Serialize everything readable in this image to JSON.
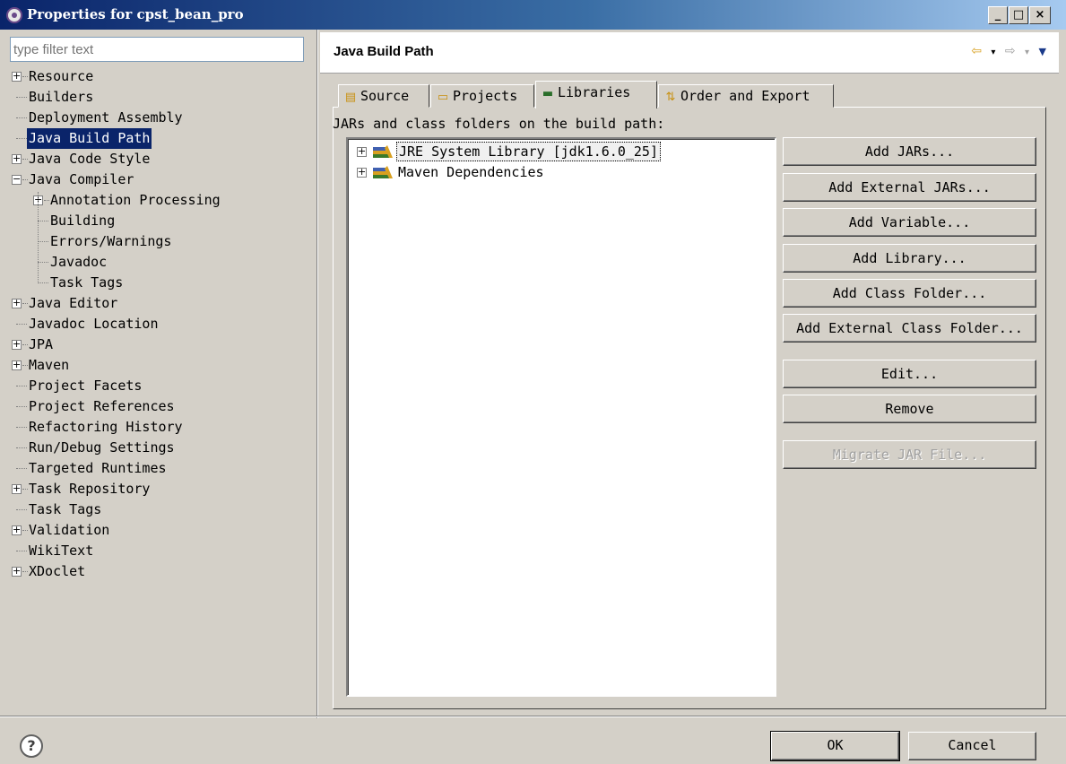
{
  "window": {
    "title": "Properties for cpst_bean_pro",
    "minimize_label": "_",
    "maximize_label": "□",
    "close_label": "×"
  },
  "filter": {
    "placeholder": "type filter text"
  },
  "tree": [
    {
      "label": "Resource",
      "expand": "+"
    },
    {
      "label": "Builders"
    },
    {
      "label": "Deployment Assembly"
    },
    {
      "label": "Java Build Path",
      "selected": true
    },
    {
      "label": "Java Code Style",
      "expand": "+"
    },
    {
      "label": "Java Compiler",
      "expand": "−"
    },
    {
      "label": "Annotation Processing",
      "expand": "+",
      "child": true
    },
    {
      "label": "Building",
      "child": true
    },
    {
      "label": "Errors/Warnings",
      "child": true
    },
    {
      "label": "Javadoc",
      "child": true
    },
    {
      "label": "Task Tags",
      "child": true
    },
    {
      "label": "Java Editor",
      "expand": "+"
    },
    {
      "label": "Javadoc Location"
    },
    {
      "label": "JPA",
      "expand": "+"
    },
    {
      "label": "Maven",
      "expand": "+"
    },
    {
      "label": "Project Facets"
    },
    {
      "label": "Project References"
    },
    {
      "label": "Refactoring History"
    },
    {
      "label": "Run/Debug Settings"
    },
    {
      "label": "Targeted Runtimes"
    },
    {
      "label": "Task Repository",
      "expand": "+"
    },
    {
      "label": "Task Tags"
    },
    {
      "label": "Validation",
      "expand": "+"
    },
    {
      "label": "WikiText"
    },
    {
      "label": "XDoclet",
      "expand": "+"
    }
  ],
  "page": {
    "title": "Java Build Path",
    "nav": {
      "back": "⇦",
      "back_menu": "▾",
      "forward": "⇨",
      "forward_menu": "▾",
      "view_menu": "▼"
    }
  },
  "tabs": [
    {
      "label": "Source",
      "icon": "source-folder-icon",
      "glyph": "▤"
    },
    {
      "label": "Projects",
      "icon": "projects-folder-icon",
      "glyph": "▭"
    },
    {
      "label": "Libraries",
      "icon": "libraries-icon",
      "glyph": "▬",
      "active": true
    },
    {
      "label": "Order and Export",
      "icon": "order-export-icon",
      "glyph": "⇅"
    }
  ],
  "libraries": {
    "caption": "JARs and class folders on the build path:",
    "items": [
      {
        "label": "JRE System Library [jdk1.6.0_25]",
        "expand": "+",
        "focused": true
      },
      {
        "label": "Maven Dependencies",
        "expand": "+"
      }
    ]
  },
  "buttons": [
    {
      "label": "Add JARs..."
    },
    {
      "label": "Add External JARs..."
    },
    {
      "label": "Add Variable..."
    },
    {
      "label": "Add Library..."
    },
    {
      "label": "Add Class Folder..."
    },
    {
      "label": "Add External Class Folder..."
    },
    {
      "label": "Edit..."
    },
    {
      "label": "Remove"
    },
    {
      "label": "Migrate JAR File...",
      "disabled": true
    }
  ],
  "footer": {
    "help": "?",
    "ok": "OK",
    "cancel": "Cancel"
  },
  "colors": {
    "selection": "#0a246a",
    "dialog_bg": "#d4d0c8"
  }
}
